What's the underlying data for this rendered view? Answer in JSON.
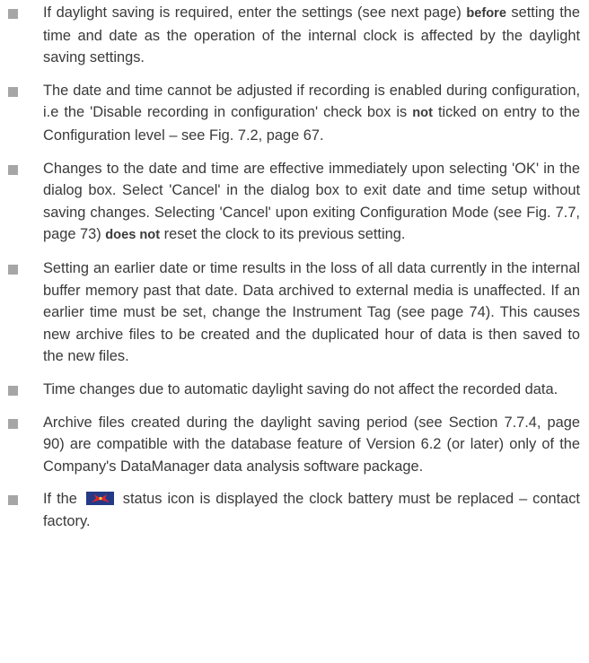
{
  "notes": [
    {
      "segments": [
        {
          "text": "If daylight saving is required, enter the settings (see next page) ",
          "bold": false
        },
        {
          "text": "before",
          "bold": true
        },
        {
          "text": " setting the time and date as the operation of the internal clock is affected by the daylight saving settings.",
          "bold": false
        }
      ]
    },
    {
      "segments": [
        {
          "text": "The date and time cannot be adjusted if recording is enabled during configuration, i.e the 'Disable recording in configuration' check box is ",
          "bold": false
        },
        {
          "text": "not",
          "bold": true
        },
        {
          "text": " ticked on entry to the Configuration level – see Fig. 7.2, page 67.",
          "bold": false
        }
      ]
    },
    {
      "segments": [
        {
          "text": "Changes to the date and time are effective immediately upon selecting 'OK' in the dialog box. Select 'Cancel' in the dialog box to exit date and time setup without saving changes. Selecting 'Cancel' upon exiting Configuration Mode (see Fig. 7.7, page 73) ",
          "bold": false
        },
        {
          "text": "does not",
          "bold": true
        },
        {
          "text": " reset the clock to its previous setting.",
          "bold": false
        }
      ]
    },
    {
      "segments": [
        {
          "text": "Setting an earlier date or time results in the loss of all data currently in the internal buffer memory past that date. Data archived to external media is unaffected. If an earlier time must be set, change the Instrument Tag (see page 74). This causes new archive files to be created and the duplicated hour of data is then saved to the new files.",
          "bold": false
        }
      ]
    },
    {
      "segments": [
        {
          "text": "Time changes due to automatic daylight saving do not affect the recorded data.",
          "bold": false
        }
      ]
    },
    {
      "segments": [
        {
          "text": "Archive files created during the daylight saving period (see Section 7.7.4, page 90) are compatible with the database feature of Version 6.2 (or later) only of the Company's DataManager data analysis software package.",
          "bold": false
        }
      ]
    },
    {
      "segments": [
        {
          "text": "If the ",
          "bold": false
        },
        {
          "icon": "clock-battery-status-icon"
        },
        {
          "text": " status icon is displayed the clock battery must be replaced – contact factory.",
          "bold": false
        }
      ]
    }
  ],
  "style": {
    "bullet_color": "#a6a6a6",
    "text_color": "#3a3a3a",
    "icon_background": "#243a86",
    "icon_accent": "#e0262b"
  }
}
